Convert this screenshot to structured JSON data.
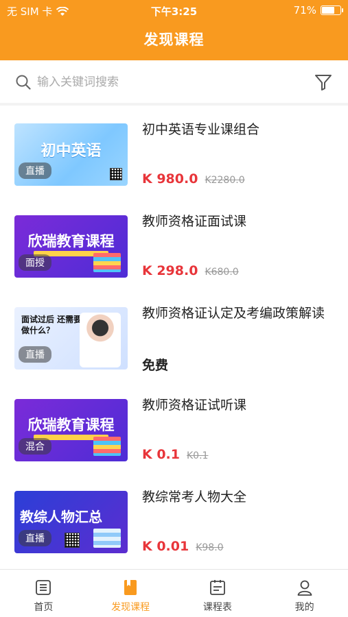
{
  "status_bar": {
    "carrier": "无 SIM 卡",
    "time": "下午3:25",
    "battery": "71%",
    "battery_level": 0.71
  },
  "header": {
    "title": "发现课程"
  },
  "search": {
    "placeholder": "输入关键词搜索"
  },
  "colors": {
    "brand": "#F99A1F",
    "price": "#E8353A"
  },
  "courses": [
    {
      "title": "初中英语专业课组合",
      "price": "K 980.0",
      "original_price": "K2280.0",
      "badge": "直播",
      "thumb_text": "初中英语"
    },
    {
      "title": "教师资格证面试课",
      "price": "K 298.0",
      "original_price": "K680.0",
      "badge": "面授",
      "thumb_text": "欣瑞教育课程"
    },
    {
      "title": "教师资格证认定及考编政策解读",
      "price_label": "免费",
      "badge": "直播",
      "thumb_text": "面试过后 还需要做什么？"
    },
    {
      "title": "教师资格证试听课",
      "price": "K 0.1",
      "original_price": "K0.1",
      "badge": "混合",
      "thumb_text": "欣瑞教育课程"
    },
    {
      "title": "教综常考人物大全",
      "price": "K 0.01",
      "original_price": "K98.0",
      "badge": "直播",
      "thumb_text": "教综人物汇总"
    }
  ],
  "tabs": [
    {
      "label": "首页",
      "icon": "home-list-icon"
    },
    {
      "label": "发现课程",
      "icon": "book-icon",
      "active": true
    },
    {
      "label": "课程表",
      "icon": "schedule-icon"
    },
    {
      "label": "我的",
      "icon": "user-icon"
    }
  ]
}
